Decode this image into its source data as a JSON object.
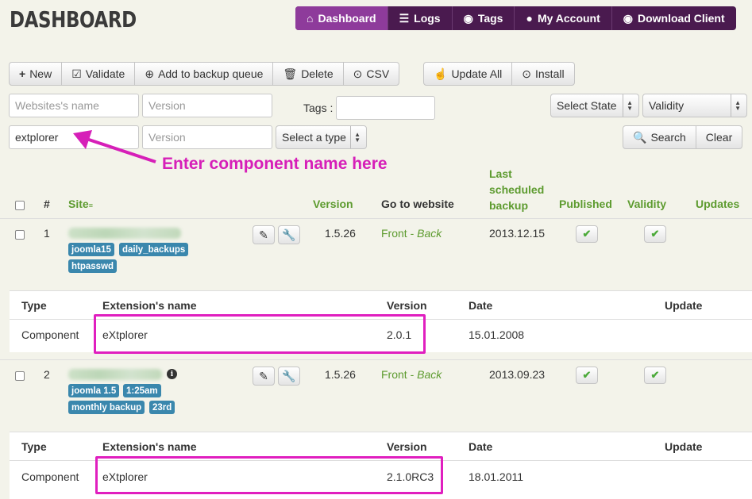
{
  "page": {
    "title": "DASHBOARD"
  },
  "nav": {
    "dashboard": "Dashboard",
    "logs": "Logs",
    "tags": "Tags",
    "account": "My Account",
    "download": "Download Client"
  },
  "toolbar": {
    "new": "New",
    "validate": "Validate",
    "add_queue": "Add to backup queue",
    "delete": "Delete",
    "csv": "CSV",
    "update_all": "Update All",
    "install": "Install"
  },
  "filters": {
    "site_name_placeholder": "Websites's name",
    "version_placeholder": "Version",
    "tags_label": "Tags :",
    "tags_value": "",
    "select_state": "Select State",
    "validity": "Validity",
    "component_value": "extplorer",
    "version2_placeholder": "Version",
    "select_type": "Select a type",
    "search": "Search",
    "clear": "Clear"
  },
  "annotation": "Enter component name here",
  "table": {
    "headers": {
      "num": "#",
      "site": "Site",
      "version": "Version",
      "goto": "Go to website",
      "last_backup_1": "Last",
      "last_backup_2": "scheduled",
      "last_backup_3": "backup",
      "published": "Published",
      "validity": "Validity",
      "updates": "Updates"
    },
    "rows": [
      {
        "num": "1",
        "tags": [
          "joomla15",
          "daily_backups",
          "htpasswd"
        ],
        "version": "1.5.26",
        "front": "Front",
        "sep": " - ",
        "back": "Back",
        "last_backup": "2013.12.15",
        "ext": {
          "h_type": "Type",
          "h_name": "Extension's name",
          "h_version": "Version",
          "h_date": "Date",
          "h_update": "Update",
          "type": "Component",
          "name": "eXtplorer",
          "version": "2.0.1",
          "date": "15.01.2008"
        }
      },
      {
        "num": "2",
        "tags": [
          "joomla 1.5",
          "1:25am",
          "monthly backup",
          "23rd"
        ],
        "version": "1.5.26",
        "front": "Front",
        "sep": " - ",
        "back": "Back",
        "last_backup": "2013.09.23",
        "ext": {
          "h_type": "Type",
          "h_name": "Extension's name",
          "h_version": "Version",
          "h_date": "Date",
          "h_update": "Update",
          "type": "Component",
          "name": "eXtplorer",
          "version": "2.1.0RC3",
          "date": "18.01.2011"
        }
      }
    ]
  },
  "colors": {
    "nav_bg": "#4a1a4f",
    "nav_active": "#8e3b9b",
    "highlight": "#e01fbf",
    "link": "#5d9b2f",
    "tag": "#3a87ad"
  }
}
